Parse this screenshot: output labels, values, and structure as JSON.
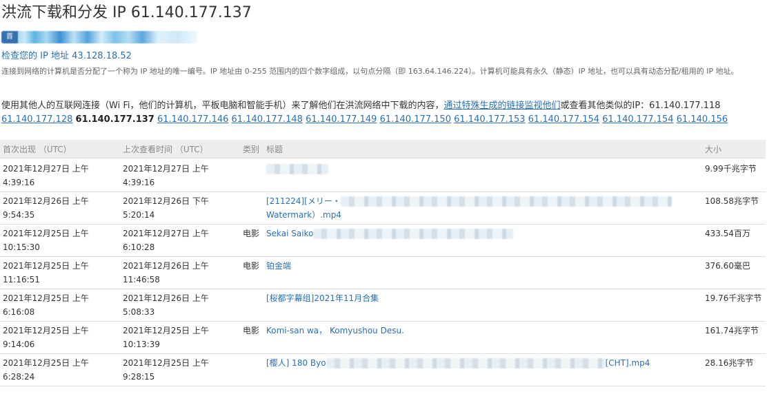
{
  "page": {
    "title": "洪流下载和分发 IP 61.140.177.137",
    "banner_badge": "首"
  },
  "check_ip": {
    "label": "检查您的 IP 地址 43.128.18.52"
  },
  "description": "连接到网络的计算机是否分配了一个称为 IP 地址的唯一编号。IP 地址由 0-255 范围内的四个数字组成，以句点分隔（即 163.64.146.224）。计算机可能具有永久（静态）IP 地址，也可以具有动态分配/租用的 IP 地址。",
  "usage": {
    "text_before": "使用其他人的互联网连接（Wi Fi，他们的计算机，平板电脑和智能手机）来了解他们在洪流网络中下载的内容，",
    "link_text": "通过特殊生成的链接监视他们",
    "text_after": "或查看其他类似的IP：",
    "ip_first": "61.140.177.118",
    "ip_before_current": "61.140.177.128",
    "ip_current": "61.140.177.137",
    "ips_after": [
      "61.140.177.146",
      "61.140.177.148",
      "61.140.177.149",
      "61.140.177.150",
      "61.140.177.153",
      "61.140.177.154",
      "61.140.177.154",
      "61.140.156"
    ]
  },
  "table": {
    "headers": {
      "first_seen": "首次出现 （UTC）",
      "last_seen": "上次查看时间 （UTC）",
      "category": "类别",
      "title": "标题",
      "size": "大小"
    },
    "rows": [
      {
        "first_seen_date": "2021年12月27日 上午",
        "first_seen_time": "4:39:16",
        "last_seen_date": "2021年12月27日 上午",
        "last_seen_time": "4:39:16",
        "category": "",
        "title_prefix": "",
        "title_suffix": "",
        "title_line2": "",
        "size": "9.99千兆字节"
      },
      {
        "first_seen_date": "2021年12月26日 上午",
        "first_seen_time": "9:54:35",
        "last_seen_date": "2021年12月26日 下午",
        "last_seen_time": "5:20:14",
        "category": "",
        "title_prefix": "[211224][メリー・",
        "title_suffix": "",
        "title_line2": "Watermark）.mp4",
        "size": "108.58兆字节"
      },
      {
        "first_seen_date": "2021年12月25日 上午",
        "first_seen_time": "10:15:30",
        "last_seen_date": "2021年12月27日 上午",
        "last_seen_time": "6:10:28",
        "category": "电影",
        "title_prefix": "Sekai Saiko",
        "title_suffix": "",
        "title_line2": "",
        "size": "433.54百万"
      },
      {
        "first_seen_date": "2021年12月25日 上午",
        "first_seen_time": "11:16:51",
        "last_seen_date": "2021年12月26日 上午",
        "last_seen_time": "11:46:58",
        "category": "电影",
        "title_prefix": "铂金端",
        "title_suffix": "",
        "title_line2": "",
        "size": "376.60毫巴"
      },
      {
        "first_seen_date": "2021年12月25日 上午",
        "first_seen_time": "6:16:08",
        "last_seen_date": "2021年12月26日 上午",
        "last_seen_time": "5:08:33",
        "category": "",
        "title_prefix": "[桜都字幕组]2021年11月合集",
        "title_suffix": "",
        "title_line2": "",
        "size": "19.76千兆字节"
      },
      {
        "first_seen_date": "2021年12月25日 上午",
        "first_seen_time": "9:14:06",
        "last_seen_date": "2021年12月25日 上午",
        "last_seen_time": "10:13:39",
        "category": "电影",
        "title_prefix": "Komi-san wa， Komyushou Desu.",
        "title_suffix": "",
        "title_line2": "",
        "size": "161.74兆字节"
      },
      {
        "first_seen_date": "2021年12月25日 上午",
        "first_seen_time": "6:28:24",
        "last_seen_date": "2021年12月25日 上午",
        "last_seen_time": "9:28:15",
        "category": "",
        "title_prefix": "[樱人] 180 Byo",
        "title_suffix": "[CHT].mp4",
        "title_line2": "",
        "size": "28.16兆字节"
      }
    ]
  }
}
